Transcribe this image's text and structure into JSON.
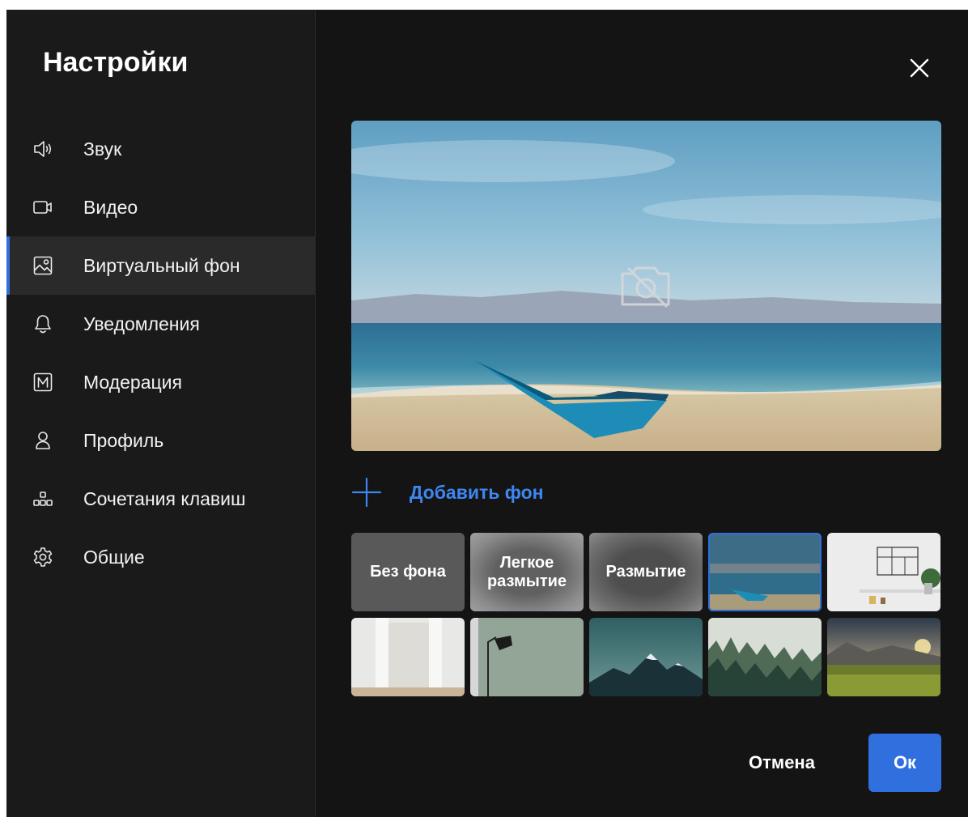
{
  "sidebar": {
    "title": "Настройки",
    "items": [
      {
        "label": "Звук",
        "icon": "speaker-icon"
      },
      {
        "label": "Видео",
        "icon": "video-camera-icon"
      },
      {
        "label": "Виртуальный фон",
        "icon": "image-icon",
        "active": true
      },
      {
        "label": "Уведомления",
        "icon": "bell-icon"
      },
      {
        "label": "Модерация",
        "icon": "moderation-m-icon"
      },
      {
        "label": "Профиль",
        "icon": "user-icon"
      },
      {
        "label": "Сочетания клавиш",
        "icon": "keyboard-shortcuts-icon"
      },
      {
        "label": "Общие",
        "icon": "gear-icon"
      }
    ]
  },
  "main": {
    "close_icon": "close-icon",
    "preview_overlay_icon": "camera-off-icon",
    "add_background_label": "Добавить фон",
    "backgrounds": {
      "options": [
        {
          "label": "Без фона"
        },
        {
          "label": "Легкое размытие"
        },
        {
          "label": "Размытие"
        }
      ],
      "images": [
        {
          "name": "beach-boat",
          "selected": true
        },
        {
          "name": "room-shelf"
        },
        {
          "name": "white-doors"
        },
        {
          "name": "lamp-wall"
        },
        {
          "name": "mountains"
        },
        {
          "name": "foggy-forest"
        },
        {
          "name": "sunset-field"
        }
      ]
    },
    "cancel_label": "Отмена",
    "ok_label": "Ок"
  },
  "colors": {
    "accent": "#2f6fde",
    "link": "#3f86f2",
    "dialog_bg": "#141414",
    "sidebar_bg": "#1a1a1a"
  }
}
